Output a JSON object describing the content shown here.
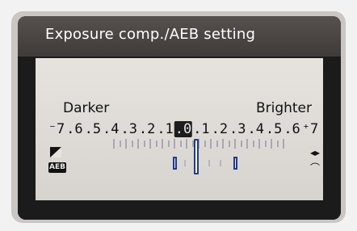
{
  "window": {
    "title": "Exposure comp./AEB setting"
  },
  "scale": {
    "left_label": "Darker",
    "right_label": "Brighter",
    "numbers": [
      "⁻7",
      ".6",
      ".5",
      ".4",
      ".3",
      ".2",
      ".1",
      ".0",
      ".1",
      ".2",
      ".3",
      ".4",
      ".5",
      ".6",
      "⁺7"
    ]
  },
  "icons": {
    "exposure_comp": "exposure-compensation-icon",
    "aeb": "AEB",
    "left_right": "◂▸",
    "dial": "⌒"
  },
  "colors": {
    "indicator": "#1f3a8f",
    "panel": "#e6e3df"
  }
}
